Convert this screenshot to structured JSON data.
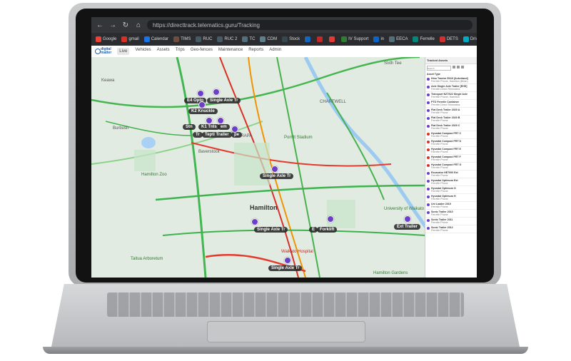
{
  "browser": {
    "url": "https://directtrack.telematics.guru/Tracking",
    "bookmarks": [
      {
        "label": "Google",
        "color": "#ea4335"
      },
      {
        "label": "gmail",
        "color": "#d93025"
      },
      {
        "label": "Calendar",
        "color": "#1a73e8"
      },
      {
        "label": "TIMS",
        "color": "#6d4c41"
      },
      {
        "label": "RUC",
        "color": "#455a64"
      },
      {
        "label": "RUC 2",
        "color": "#455a64"
      },
      {
        "label": "TC",
        "color": "#546e7a"
      },
      {
        "label": "CDM",
        "color": "#607d8b"
      },
      {
        "label": "Stock",
        "color": "#37474f"
      },
      {
        "label": "",
        "color": "#1565c0"
      },
      {
        "label": "",
        "color": "#c62828"
      },
      {
        "label": "",
        "color": "#e53935"
      },
      {
        "label": "IV Support",
        "color": "#2e7d32"
      },
      {
        "label": "in",
        "color": "#0a66c2"
      },
      {
        "label": "EECA",
        "color": "#546e7a"
      },
      {
        "label": "Ferrelle",
        "color": "#00897b"
      },
      {
        "label": "DETS",
        "color": "#d32f2f"
      },
      {
        "label": "Drive Electric",
        "color": "#00acc1"
      }
    ]
  },
  "app": {
    "logo_line1": "digital",
    "logo_line2": "matter",
    "menu": [
      "Live",
      "Vehicles",
      "Assets",
      "Trips",
      "Geo-fences",
      "Maintenance",
      "Reports",
      "Admin"
    ]
  },
  "panel": {
    "title": "Tracked Assets",
    "search_placeholder": "Search",
    "tab": "Asset Type",
    "vehicles": [
      {
        "name": "Hino Tractor ZN10 [Ackerland]",
        "desc": "Ferrelle Phone, Hamilton (Brian)",
        "red": false
      },
      {
        "name": "Axle Single Axle Trailer [EHS]",
        "desc": "Ferrelle Direct Telematics",
        "red": false
      },
      {
        "name": "Transport NZ7S22 Single Axle",
        "desc": "Ferrelle Phone, Hamilton",
        "red": false
      },
      {
        "name": "PTO Ferrelle Container",
        "desc": "Ferrelle Direct Telematics",
        "red": false
      },
      {
        "name": "Flat Deck Trailer 2020 A",
        "desc": "Ferrelle Phone",
        "red": false
      },
      {
        "name": "Flat Deck Trailer 2020 B",
        "desc": "Ferrelle Phone",
        "red": false
      },
      {
        "name": "Flat Deck Trailer 2020 C",
        "desc": "Ferrelle Phone",
        "red": false
      },
      {
        "name": "Hyundai Compact FRT C",
        "desc": "Ferrelle Phone",
        "red": true
      },
      {
        "name": "Hyundai Compact FRT D",
        "desc": "Ferrelle Phone",
        "red": true
      },
      {
        "name": "Hyundai Compact FRT E",
        "desc": "Ferrelle Phone",
        "red": true
      },
      {
        "name": "Hyundai Compact FRT F",
        "desc": "Ferrelle Phone",
        "red": true
      },
      {
        "name": "Hyundai Compact FRT G",
        "desc": "Ferrelle Phone",
        "red": true
      },
      {
        "name": "Excavator HE7000 Ext",
        "desc": "Ferrelle Phone",
        "red": false
      },
      {
        "name": "Hyundai Optimum Ext",
        "desc": "Ferrelle Phone",
        "red": false
      },
      {
        "name": "Hyundai Optimum G",
        "desc": "Ferrelle Phone",
        "red": false
      },
      {
        "name": "Hyundai Optimum H",
        "desc": "Ferrelle Phone",
        "red": false
      },
      {
        "name": "Uni Loader 2019",
        "desc": "Ferrelle Phone",
        "red": false
      },
      {
        "name": "Sonic Trailer 2010",
        "desc": "Ferrelle Phone",
        "red": false
      },
      {
        "name": "Sonic Trailer 2011",
        "desc": "Ferrelle Phone",
        "red": false
      },
      {
        "name": "Sonic Trailer 2012",
        "desc": "Ferrelle Phone",
        "red": false
      }
    ]
  },
  "map": {
    "labels": [
      "E4 Opto",
      "Single Axle Tr",
      "K2 Knuckle",
      "Stn",
      "K1 Tnls",
      "em",
      "Tr",
      "Tepti Trailer",
      "pe",
      "Single Axle Tr",
      "Single Axle Tr",
      "E",
      "Forklift",
      "Ext Trailer",
      "Single Axle Tr"
    ],
    "places": {
      "hamilton": "Hamilton",
      "porritt": "Porritt Stadium",
      "hospital": "Waikato Hospital",
      "zoo": "Hamilton Zoo",
      "arboretum": "Taitua Arboretum",
      "burbush": "Burbush",
      "baverstock": "Baverstock",
      "university": "University of Waikato",
      "gardens": "Hamilton Gardens",
      "kewa": "Keawa",
      "sixth": "Sixth Tee",
      "tehapa": "TE RAPA",
      "chartwell": "CHARTWELL"
    }
  }
}
